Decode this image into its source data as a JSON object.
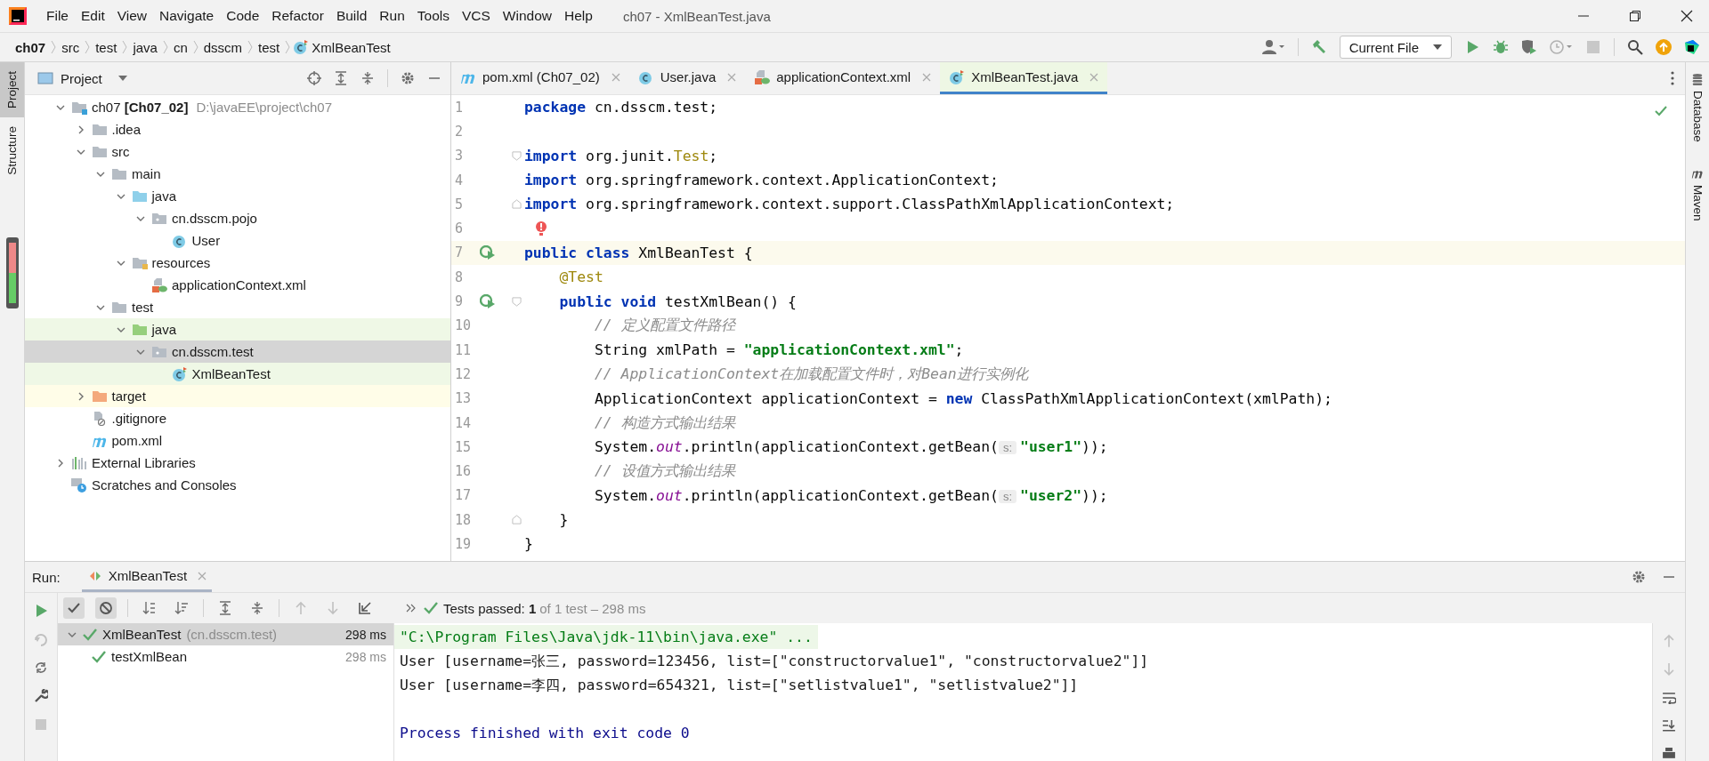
{
  "menu": [
    "File",
    "Edit",
    "View",
    "Navigate",
    "Code",
    "Refactor",
    "Build",
    "Run",
    "Tools",
    "VCS",
    "Window",
    "Help"
  ],
  "window": {
    "title": "ch07 - XmlBeanTest.java"
  },
  "breadcrumbs": [
    {
      "label": "ch07",
      "kind": "root"
    },
    {
      "label": "src",
      "kind": "dir"
    },
    {
      "label": "test",
      "kind": "dir"
    },
    {
      "label": "java",
      "kind": "dir"
    },
    {
      "label": "cn",
      "kind": "dir"
    },
    {
      "label": "dsscm",
      "kind": "dir"
    },
    {
      "label": "test",
      "kind": "dir"
    },
    {
      "label": "XmlBeanTest",
      "kind": "class"
    }
  ],
  "run_config": "Current File",
  "left_stripe": [
    {
      "label": "Project",
      "selected": true
    },
    {
      "label": "Structure",
      "selected": false
    }
  ],
  "right_stripe": [
    {
      "label": "Database",
      "kind": "database"
    },
    {
      "label": "Maven",
      "kind": "maven"
    }
  ],
  "project_panel": {
    "title": "Project",
    "tree": [
      {
        "name": "ch07 **[Ch07_02]**",
        "hint": "D:\\javaEE\\project\\ch07",
        "kind": "module",
        "expanded": true,
        "selected": false,
        "children": [
          {
            "name": ".idea",
            "kind": "folder",
            "expanded": false,
            "selected": false
          },
          {
            "name": "src",
            "kind": "folder",
            "expanded": true,
            "selected": false,
            "children": [
              {
                "name": "main",
                "kind": "folder",
                "expanded": true,
                "selected": false,
                "children": [
                  {
                    "name": "java",
                    "kind": "source-folder",
                    "expanded": true,
                    "selected": false,
                    "children": [
                      {
                        "name": "cn.dsscm.pojo",
                        "kind": "package",
                        "expanded": true,
                        "selected": false,
                        "children": [
                          {
                            "name": "User",
                            "kind": "class",
                            "selected": false
                          }
                        ]
                      }
                    ]
                  },
                  {
                    "name": "resources",
                    "kind": "resource-folder",
                    "expanded": true,
                    "selected": false,
                    "children": [
                      {
                        "name": "applicationContext.xml",
                        "kind": "spring-xml",
                        "selected": false
                      }
                    ]
                  }
                ]
              },
              {
                "name": "test",
                "kind": "folder",
                "expanded": true,
                "selected": false,
                "children": [
                  {
                    "name": "java",
                    "kind": "test-folder",
                    "expanded": true,
                    "selected": false,
                    "children": [
                      {
                        "name": "cn.dsscm.test",
                        "kind": "package",
                        "expanded": true,
                        "selected": true,
                        "children": [
                          {
                            "name": "XmlBeanTest",
                            "kind": "test-class",
                            "selected": false
                          }
                        ]
                      }
                    ]
                  }
                ]
              }
            ]
          },
          {
            "name": "target",
            "kind": "excluded-folder",
            "expanded": false,
            "selected": false
          },
          {
            "name": ".gitignore",
            "kind": "ignore-file",
            "selected": false
          },
          {
            "name": "pom.xml",
            "kind": "maven",
            "selected": false
          }
        ]
      },
      {
        "name": "External Libraries",
        "kind": "libraries",
        "expanded": false,
        "selected": false
      },
      {
        "name": "Scratches and Consoles",
        "kind": "scratches",
        "selected": false
      }
    ]
  },
  "tabs": [
    {
      "label": "pom.xml (Ch07_02)",
      "kind": "maven",
      "selected": false
    },
    {
      "label": "User.java",
      "kind": "class",
      "selected": false
    },
    {
      "label": "applicationContext.xml",
      "kind": "spring-xml",
      "selected": false
    },
    {
      "label": "XmlBeanTest.java",
      "kind": "test-class",
      "selected": true
    }
  ],
  "editor": {
    "lines": [
      {
        "number": "1",
        "tokens": [
          {
            "kind": "kw",
            "text": "package"
          },
          {
            "kind": "plain",
            "text": " cn.dsscm.test;"
          }
        ]
      },
      {
        "number": "2"
      },
      {
        "number": "3",
        "fold_start": true,
        "tokens": [
          {
            "kind": "kw",
            "text": "import"
          },
          {
            "kind": "plain",
            "text": " org.junit."
          },
          {
            "kind": "ann",
            "text": "Test"
          },
          {
            "kind": "plain",
            "text": ";"
          }
        ]
      },
      {
        "number": "4",
        "tokens": [
          {
            "kind": "kw",
            "text": "import"
          },
          {
            "kind": "plain",
            "text": " org.springframework.context.ApplicationContext;"
          }
        ]
      },
      {
        "number": "5",
        "fold_end": true,
        "tokens": [
          {
            "kind": "kw",
            "text": "import"
          },
          {
            "kind": "plain",
            "text": " org.springframework.context.support.ClassPathXmlApplicationContext;"
          }
        ]
      },
      {
        "number": "6",
        "bulb": true
      },
      {
        "number": "7",
        "run": true,
        "current": true,
        "tokens": [
          {
            "kind": "kw",
            "text": "public class"
          },
          {
            "kind": "plain",
            "text": " XmlBeanTest {"
          }
        ]
      },
      {
        "number": "8",
        "tokens": [
          {
            "kind": "ann",
            "text": "    @Test"
          }
        ]
      },
      {
        "number": "9",
        "run": true,
        "fold_start": true,
        "tokens": [
          {
            "kind": "kw",
            "text": "    public void"
          },
          {
            "kind": "plain",
            "text": " testXmlBean() {"
          }
        ]
      },
      {
        "number": "10",
        "tokens": [
          {
            "kind": "comment",
            "text": "        // 定义配置文件路径"
          }
        ]
      },
      {
        "number": "11",
        "tokens": [
          {
            "kind": "plain",
            "text": "        String xmlPath = "
          },
          {
            "kind": "str",
            "text": "\"applicationContext.xml\""
          },
          {
            "kind": "plain",
            "text": ";"
          }
        ]
      },
      {
        "number": "12",
        "tokens": [
          {
            "kind": "comment",
            "text": "        // ApplicationContext在加载配置文件时，对Bean进行实例化"
          }
        ]
      },
      {
        "number": "13",
        "tokens": [
          {
            "kind": "plain",
            "text": "        ApplicationContext applicationContext = "
          },
          {
            "kind": "kw",
            "text": "new"
          },
          {
            "kind": "plain",
            "text": " ClassPathXmlApplicationContext(xmlPath);"
          }
        ]
      },
      {
        "number": "14",
        "tokens": [
          {
            "kind": "comment",
            "text": "        // 构造方式输出结果"
          }
        ]
      },
      {
        "number": "15",
        "tokens": [
          {
            "kind": "plain",
            "text": "        System."
          },
          {
            "kind": "static",
            "text": "out"
          },
          {
            "kind": "plain",
            "text": ".println(applicationContext.getBean("
          },
          {
            "kind": "hint",
            "text": "s:"
          },
          {
            "kind": "str",
            "text": "\"user1\""
          },
          {
            "kind": "plain",
            "text": "));"
          }
        ]
      },
      {
        "number": "16",
        "tokens": [
          {
            "kind": "comment",
            "text": "        // 设值方式输出结果"
          }
        ]
      },
      {
        "number": "17",
        "tokens": [
          {
            "kind": "plain",
            "text": "        System."
          },
          {
            "kind": "static",
            "text": "out"
          },
          {
            "kind": "plain",
            "text": ".println(applicationContext.getBean("
          },
          {
            "kind": "hint",
            "text": "s:"
          },
          {
            "kind": "str",
            "text": "\"user2\""
          },
          {
            "kind": "plain",
            "text": "));"
          }
        ]
      },
      {
        "number": "18",
        "fold_end": true,
        "tokens": [
          {
            "kind": "plain",
            "text": "    }"
          }
        ]
      },
      {
        "number": "19",
        "tokens": [
          {
            "kind": "plain",
            "text": "}"
          }
        ]
      }
    ]
  },
  "run_panel": {
    "label": "Run:",
    "tab": "XmlBeanTest",
    "status": "Tests passed: **1**",
    "status_detail": "of 1 test – 298 ms",
    "tests": [
      {
        "name": "XmlBeanTest",
        "hint": "(cn.dsscm.test)",
        "time": "298 ms",
        "passed": true,
        "selected": true,
        "expanded": true,
        "children": [
          {
            "name": "testXmlBean",
            "time": "298 ms",
            "passed": true,
            "selected": false
          }
        ]
      }
    ],
    "console": [
      {
        "kind": "command",
        "text": "\"C:\\Program Files\\Java\\jdk-11\\bin\\java.exe\" ..."
      },
      {
        "kind": "output",
        "text": "User [username=张三, password=123456, list=[\"constructorvalue1\", \"constructorvalue2\"]]"
      },
      {
        "kind": "output",
        "text": "User [username=李四, password=654321, list=[\"setlistvalue1\", \"setlistvalue2\"]]"
      },
      {
        "kind": "exit",
        "text": "Process finished with exit code 0"
      }
    ]
  }
}
